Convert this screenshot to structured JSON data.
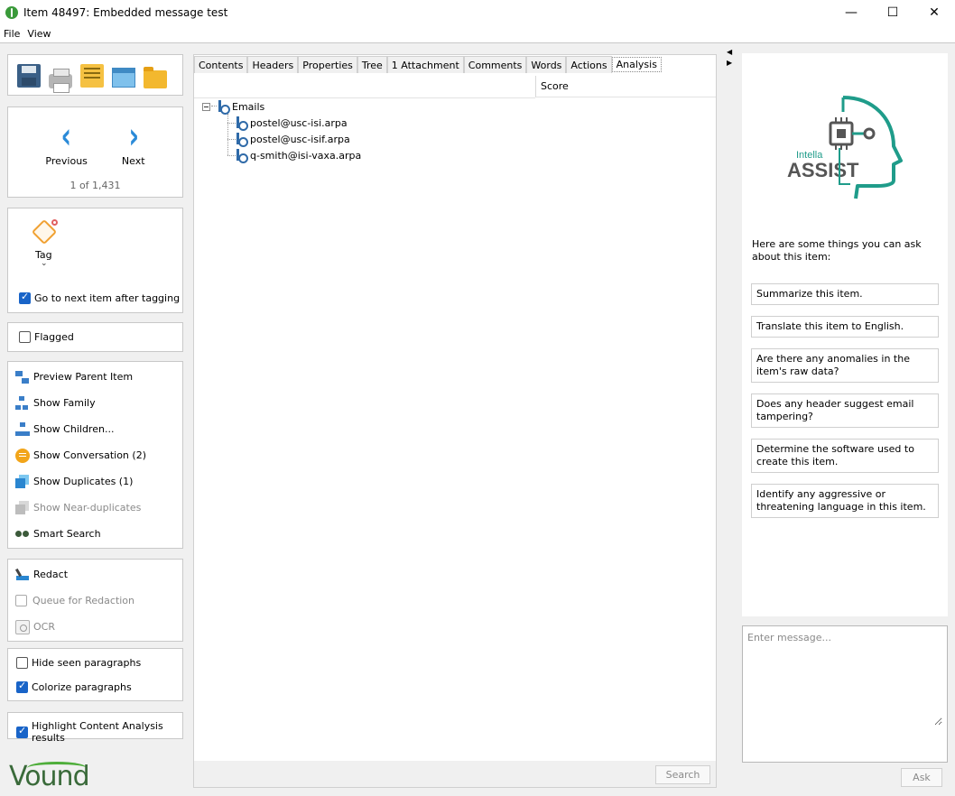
{
  "window": {
    "title": "Item 48497: Embedded message test",
    "minimize_glyph": "—",
    "maximize_glyph": "☐",
    "close_glyph": "✕"
  },
  "menu": [
    "File",
    "View"
  ],
  "toolbar": {
    "icons": [
      "save-icon",
      "print-icon",
      "note-icon",
      "window-icon",
      "folder-icon"
    ]
  },
  "navigation": {
    "previous_label": "Previous",
    "next_label": "Next",
    "count": "1 of 1,431",
    "prev_glyph": "‹",
    "next_glyph": "›"
  },
  "tagging": {
    "tag_label": "Tag",
    "expand_glyph": "⌄",
    "next_after_tagging_label": "Go to next item after tagging",
    "next_after_tagging_checked": true
  },
  "flagged": {
    "label": "Flagged",
    "checked": false
  },
  "actions": [
    {
      "label": "Preview Parent Item",
      "icon": "parent-icon",
      "enabled": true
    },
    {
      "label": "Show Family",
      "icon": "family-icon",
      "enabled": true
    },
    {
      "label": "Show Children...",
      "icon": "children-icon",
      "enabled": true
    },
    {
      "label": "Show Conversation (2)",
      "icon": "conversation-icon",
      "enabled": true
    },
    {
      "label": "Show Duplicates (1)",
      "icon": "duplicates-icon",
      "enabled": true
    },
    {
      "label": "Show Near-duplicates",
      "icon": "near-duplicates-icon",
      "enabled": false
    },
    {
      "label": "Smart Search",
      "icon": "binoculars-icon",
      "enabled": true
    }
  ],
  "redaction": {
    "redact_label": "Redact",
    "queue_label": "Queue for Redaction",
    "ocr_label": "OCR"
  },
  "paragraphs": {
    "hide_seen_label": "Hide seen paragraphs",
    "hide_seen_checked": false,
    "colorize_label": "Colorize paragraphs",
    "colorize_checked": true
  },
  "highlight": {
    "label": "Highlight Content Analysis results",
    "checked": true
  },
  "brand": {
    "logo_text": "Vound",
    "accent": "#4fae3b"
  },
  "tabs": [
    "Contents",
    "Headers",
    "Properties",
    "Tree",
    "1 Attachment",
    "Comments",
    "Words",
    "Actions",
    "Analysis"
  ],
  "active_tab": "Analysis",
  "analysis": {
    "score_header": "Score",
    "tree": {
      "root": "Emails",
      "children": [
        "postel@usc-isi.arpa",
        "postel@usc-isif.arpa",
        "q-smith@isi-vaxa.arpa"
      ]
    },
    "search_label": "Search"
  },
  "assist": {
    "logo_small": "Intella",
    "logo_big": "ASSIST",
    "logo_color": "#1f9c8a",
    "intro": "Here are some things you can ask about this item:",
    "suggestions": [
      "Summarize this item.",
      "Translate this item to English.",
      "Are there any anomalies in the item's raw data?",
      "Does any header suggest email tampering?",
      "Determine the software used to create this item.",
      "Identify any aggressive or threatening language in this item."
    ],
    "message_placeholder": "Enter message...",
    "ask_label": "Ask"
  },
  "panel_toggles": {
    "collapse_left": "◀",
    "collapse_right": "▶"
  }
}
